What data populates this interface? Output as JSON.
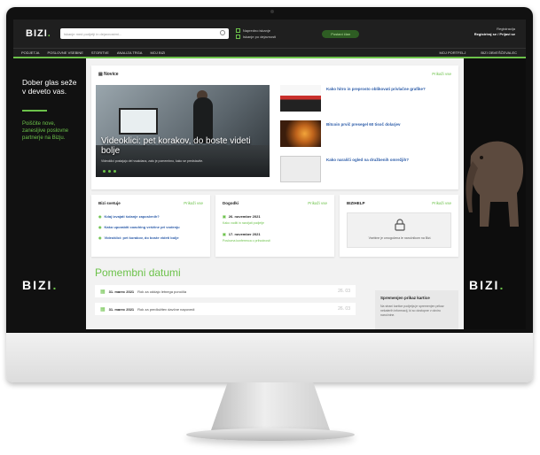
{
  "header": {
    "logo": "BIZI",
    "search_placeholder": "Iskanje med podjetji in dejavnostmi...",
    "checks": [
      "Napredno iskanje",
      "Iskanje po dejavnosti"
    ],
    "pill": "Postani član",
    "account_label": "Registracija",
    "account_links": "Registriraj se / Prijavi se"
  },
  "nav": {
    "items": [
      "Podjetja",
      "Poslovne vsebine",
      "Storitve",
      "Analiza trga",
      "Moj Bizi"
    ],
    "right": [
      "Moj portfelj",
      "Bizi obveščevalec"
    ]
  },
  "left_banner": {
    "title": "Dober glas seže v deveto vas.",
    "subtitle": "Poiščite nove, zanesljive poslovne partnerje na Bizju.",
    "logo": "BIZI"
  },
  "right_banner": {
    "logo": "BIZI"
  },
  "news": {
    "title": "Novice",
    "more": "Prikaži vse",
    "hero_title": "Videoklici: pet korakov, do boste videti bolje",
    "hero_sub": "Videoklici postajajo del vsakdana, zato je pomembno, kako se predstavite.",
    "items": [
      "Kako hitro in preprosto oblikovati privlačne grafike?",
      "Bitcoin prvič presegel 60 tisoč dolarjev",
      "Kako narašči ogled na družbenih omrežjih?"
    ]
  },
  "cards": {
    "bizi_svetuje": {
      "title": "Bizi svetuje",
      "more": "Prikaži vse",
      "links": [
        "Kdaj izvajati šolanje zaposlenih?",
        "Kako uporabiti coaching veščine pri vodenju",
        "Videoklici: pet korakov, do boste videti bolje"
      ]
    },
    "dogodki": {
      "title": "Dogodki",
      "more": "Prikaži vse",
      "events": [
        {
          "date": "26. november 2021",
          "desc": "Kako voditi in razvijati podjetje"
        },
        {
          "date": "17. november 2021",
          "desc": "Poslovna konferenca o prihodnosti"
        }
      ]
    },
    "bizihelp": {
      "title": "BIZIHELP",
      "more": "Prikaži vse",
      "locked_text": "Vsebine je omogočena le naročnikom na Bizi."
    }
  },
  "dates": {
    "title": "Pomembni datumi",
    "rows": [
      {
        "date": "31. marec 2021",
        "text": "Rok za oddajo letnega poročila",
        "num": "26. 03"
      },
      {
        "date": "31. marec 2021",
        "text": "Rok za predložitev davčne napovedi",
        "num": "26. 03"
      }
    ]
  },
  "info_card": {
    "title": "Spremenjen prikaz kartice",
    "body": "Na strani kartice podjetja je spremenjen prikaz nekaterih informacij, ki so dostopne v okviru naročnine."
  }
}
